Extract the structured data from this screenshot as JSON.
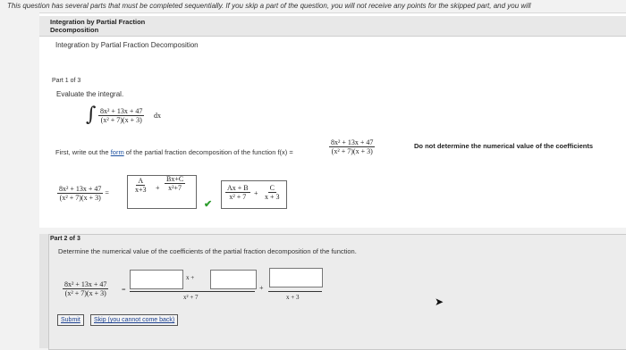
{
  "notice": "This question has several parts that must be completed sequentially. If you skip a part of the question, you will not receive any points for the skipped part, and you will",
  "header": {
    "title_line1": "Integration by Partial Fraction",
    "title_line2": "Decomposition"
  },
  "subtitle": "Integration by Partial Fraction Decomposition",
  "part1": {
    "label": "Part 1 of 3",
    "prompt": "Evaluate the integral.",
    "integrand_num": "8x² + 13x + 47",
    "integrand_den": "(x² + 7)(x + 3)",
    "dx": "dx",
    "instruction_pre": "First, write out the ",
    "instruction_link": "form",
    "instruction_post": " of the partial fraction decomposition of the function f(x) =",
    "fx_num": "8x² + 13x + 47",
    "fx_den": "(x² + 7)(x + 3)",
    "note": "Do not determine the numerical value of the coefficients",
    "lhs_num": "8x² + 13x + 47",
    "lhs_den": "(x² + 7)(x + 3)",
    "eq": "=",
    "ans_a_num": "A",
    "ans_a_den": "x+3",
    "ans_plus": "+",
    "ans_b_num": "Bx+C",
    "ans_b_den": "x²+7",
    "check": "✔",
    "final_a_num": "Ax + B",
    "final_a_den": "x² + 7",
    "final_plus": "+",
    "final_b_num": "C",
    "final_b_den": "x + 3"
  },
  "part2": {
    "label": "Part 2 of 3",
    "prompt": "Determine the numerical value of the coefficients of the partial fraction decomposition of the function.",
    "lhs_num": "8x² + 13x + 47",
    "lhs_den": "(x² + 7)(x + 3)",
    "eq": "=",
    "xplus": "x +",
    "den1": "x² + 7",
    "plus": "+",
    "den2": "x + 3",
    "submit": "Submit",
    "skip": "Skip (you cannot come back)"
  }
}
